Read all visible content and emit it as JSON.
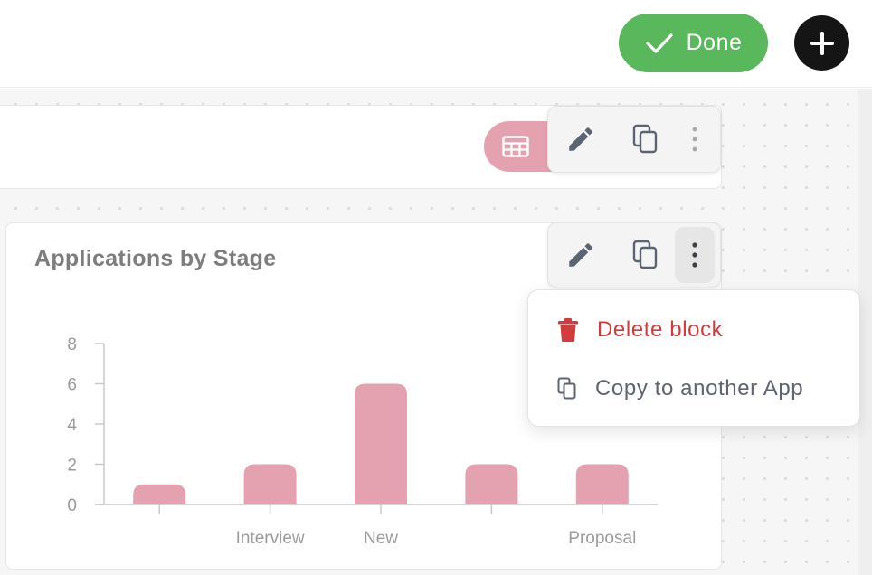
{
  "header": {
    "done_label": "Done"
  },
  "blocks": [
    {
      "kind": "table-view",
      "toolbar": {
        "menu_open": false
      }
    },
    {
      "kind": "chart",
      "title": "Applications by Stage",
      "toolbar": {
        "menu_open": true
      }
    }
  ],
  "menu": {
    "items": [
      {
        "label": "Delete block",
        "icon": "trash-icon",
        "color": "#d23c3c"
      },
      {
        "label": "Copy to another App",
        "icon": "copy-icon",
        "color": "#5e6470"
      }
    ]
  },
  "colors": {
    "done": "#59b85c",
    "bar": "#e4a2b0",
    "danger": "#d23c3c"
  },
  "chart_data": {
    "type": "bar",
    "title": "Applications by Stage",
    "categories": [
      "",
      "Interview",
      "New",
      "",
      "Proposal"
    ],
    "values": [
      1,
      2,
      6,
      2,
      2
    ],
    "yticks": [
      0,
      2,
      4,
      6,
      8
    ],
    "ylim": [
      0,
      8
    ],
    "xlabel": "",
    "ylabel": "",
    "grid": false
  }
}
